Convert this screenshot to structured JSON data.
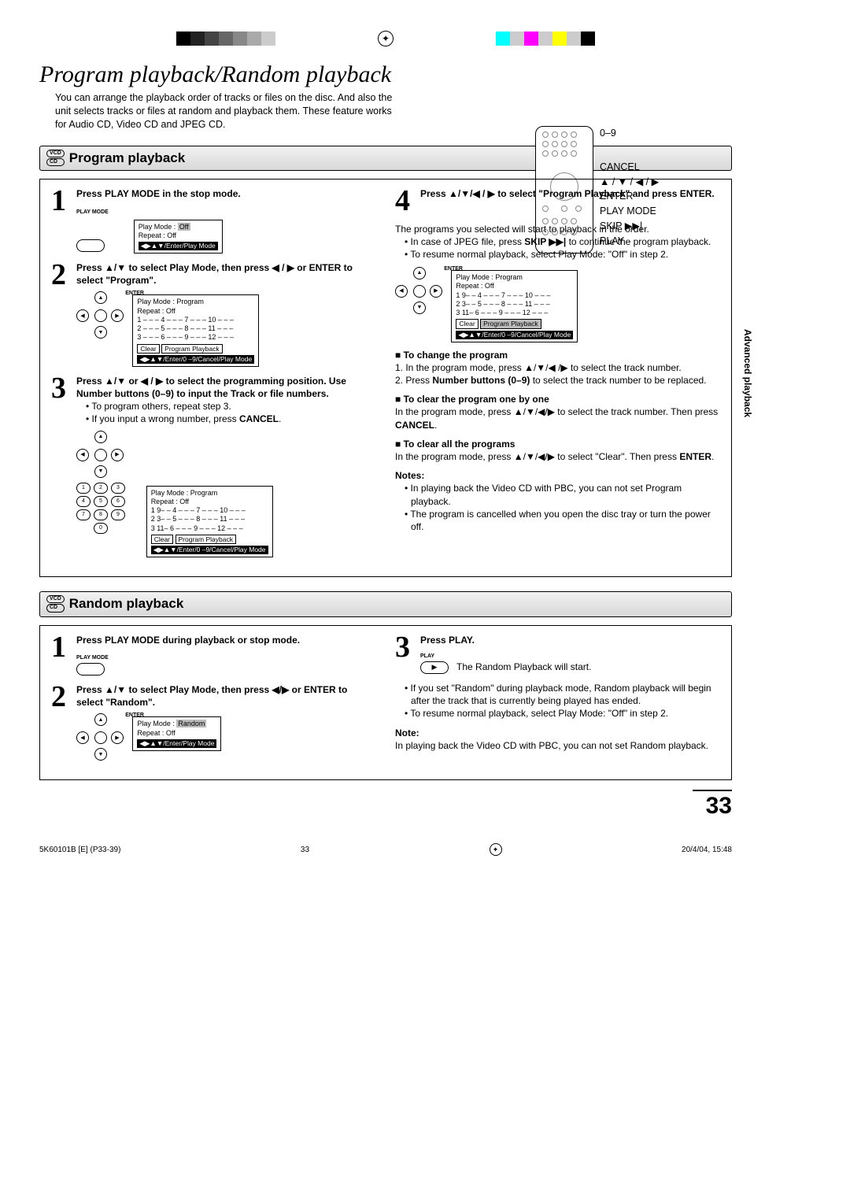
{
  "title": "Program playback/Random playback",
  "intro": "You can arrange the playback order of tracks or files on the disc. And also the unit selects tracks or files at random and playback them. These feature works for Audio CD, Video CD and JPEG CD.",
  "remote": {
    "labels": [
      "0–9",
      "CANCEL",
      "▲ / ▼ / ◀ / ▶",
      "ENTER",
      "PLAY MODE",
      "SKIP ▶▶|",
      "PLAY"
    ]
  },
  "disc_badges": [
    "VCD",
    "CD"
  ],
  "section_program": "Program playback",
  "section_random": "Random playback",
  "side_tab": "Advanced playback",
  "page_number": "33",
  "footer": {
    "left": "5K60101B [E] (P33-39)",
    "mid": "33",
    "right": "20/4/04, 15:48"
  },
  "prog": {
    "s1": {
      "head": "Press PLAY MODE in the stop mode.",
      "btnlabel": "PLAY MODE",
      "osd": {
        "l1": "Play Mode       :",
        "l1v": "Off",
        "l2": "Repeat            : Off",
        "foot": "◀▶▲▼/Enter/Play Mode"
      }
    },
    "s2": {
      "head": "Press ▲/▼ to select Play Mode, then press ◀ / ▶ or ENTER to select \"Program\".",
      "osd": {
        "l1": "Play Mode        : Program",
        "l2": "Repeat             : Off",
        "g1": "1 – – –    4 – – –    7 – – –    10 – – –",
        "g2": "2 – – –    5 – – –    8 – – –    11 – – –",
        "g3": "3 – – –    6 – – –    9 – – –    12 – – –",
        "btn1": "Clear",
        "btn2": "Program Playback",
        "foot": "◀▶▲▼/Enter/0 –9/Cancel/Play Mode"
      }
    },
    "s3": {
      "head": "Press ▲/▼ or ◀ / ▶ to select the programming position. Use Number buttons (0–9) to input the Track or file numbers.",
      "b1": "To program others, repeat step 3.",
      "b2": "If you input a wrong number, press",
      "b2b": "CANCEL",
      "osd": {
        "l1": "Play Mode        : Program",
        "l2": "Repeat             : Off",
        "g1": "1  9– –    4 – – –    7 – – –    10 – – –",
        "g2": "2  3– –    5 – – –    8 – – –    11 – – –",
        "g3": "3 11–     6 – – –    9 – – –    12 – – –",
        "btn1": "Clear",
        "btn2": "Program Playback",
        "foot": "◀▶▲▼/Enter/0 –9/Cancel/Play Mode"
      }
    },
    "s4": {
      "head": "Press ▲/▼/◀ / ▶ to select \"Program Playback\" and press ENTER.",
      "p1": "The programs you selected will start to playback in the order.",
      "b1a": "In case of JPEG file, press ",
      "b1b": "SKIP ▶▶|",
      "b1c": " to continue the program playback.",
      "b2": "To resume normal playback, select Play Mode: \"Off\" in step 2.",
      "osd": {
        "l1": "Play Mode        : Program",
        "l2": "Repeat             : Off",
        "g1": "1  9– –    4 – – –    7 – – –    10 – – –",
        "g2": "2  3– –    5 – – –    8 – – –    11 – – –",
        "g3": "3 11–     6 – – –    9 – – –    12 – – –",
        "btn1": "Clear",
        "btn2": "Program Playback",
        "foot": "◀▶▲▼/Enter/0 –9/Cancel/Play Mode"
      }
    },
    "change_h": "To change the program",
    "change_1": "1. In the program mode, press ▲/▼/◀ /▶ to select the track number.",
    "change_2a": "2. Press ",
    "change_2b": "Number buttons (0–9)",
    "change_2c": " to select the track number to be replaced.",
    "clear1_h": "To clear the program one by one",
    "clear1_pa": "In the program mode, press ▲/▼/◀/▶ to select the track number. Then press ",
    "clear1_pb": "CANCEL",
    "clear1_pc": ".",
    "clearall_h": "To clear all the programs",
    "clearall_pa": "In the program mode, press ▲/▼/◀/▶ to select \"Clear\". Then press ",
    "clearall_pb": "ENTER",
    "clearall_pc": ".",
    "notes_h": "Notes:",
    "note1": "In playing back the Video CD with PBC, you can not set Program playback.",
    "note2": "The program is cancelled when you open the disc tray or turn the power off."
  },
  "rand": {
    "s1": {
      "head": "Press PLAY MODE during playback or stop mode.",
      "btnlabel": "PLAY MODE"
    },
    "s2": {
      "head": "Press ▲/▼ to select Play Mode, then press ◀/▶ or ENTER to select \"Random\".",
      "osd": {
        "l1": "Play Mode       :",
        "l1v": "Random",
        "l2": "Repeat            : Off",
        "foot": "◀▶▲▼/Enter/Play Mode"
      }
    },
    "s3": {
      "head": "Press PLAY.",
      "btnlabel": "PLAY",
      "p1": "The Random Playback will start.",
      "b1": "If you set \"Random\" during playback mode, Random playback will begin after the track that is currently being played has ended.",
      "b2": "To resume normal playback, select Play Mode: \"Off\" in step 2."
    },
    "note_h": "Note:",
    "note": "In playing back the Video CD with PBC, you can not set Random playback."
  }
}
